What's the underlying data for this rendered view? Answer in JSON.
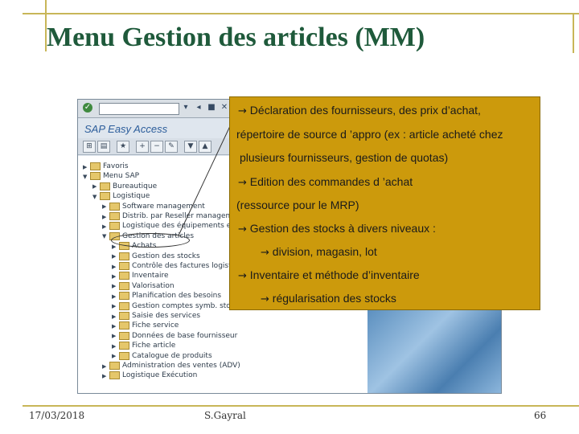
{
  "slide": {
    "title": "Menu Gestion des articles (MM)",
    "footer_date": "17/03/2018",
    "footer_author": "S.Gayral",
    "footer_page": "66"
  },
  "sap": {
    "screen_title": "SAP Easy Access",
    "tree": [
      {
        "label": "Favoris",
        "level": 0,
        "expanded": false
      },
      {
        "label": "Menu SAP",
        "level": 0,
        "expanded": true
      },
      {
        "label": "Bureautique",
        "level": 1,
        "expanded": false
      },
      {
        "label": "Logistique",
        "level": 1,
        "expanded": true
      },
      {
        "label": "Software management",
        "level": 2,
        "expanded": false
      },
      {
        "label": "Distrib. par Reseller management",
        "level": 2,
        "expanded": false
      },
      {
        "label": "Logistique des équipements et clie",
        "level": 2,
        "expanded": false
      },
      {
        "label": "Gestion des articles",
        "level": 2,
        "expanded": true
      },
      {
        "label": "Achats",
        "level": 3,
        "expanded": false
      },
      {
        "label": "Gestion des stocks",
        "level": 3,
        "expanded": false
      },
      {
        "label": "Contrôle des factures logistique",
        "level": 3,
        "expanded": false
      },
      {
        "label": "Inventaire",
        "level": 3,
        "expanded": false
      },
      {
        "label": "Valorisation",
        "level": 3,
        "expanded": false
      },
      {
        "label": "Planification des besoins",
        "level": 3,
        "expanded": false
      },
      {
        "label": "Gestion comptes symb. stocks consignation",
        "level": 3,
        "expanded": false
      },
      {
        "label": "Saisie des services",
        "level": 3,
        "expanded": false
      },
      {
        "label": "Fiche service",
        "level": 3,
        "expanded": false
      },
      {
        "label": "Données de base fournisseur",
        "level": 3,
        "expanded": false
      },
      {
        "label": "Fiche article",
        "level": 3,
        "expanded": false
      },
      {
        "label": "Catalogue de produits",
        "level": 3,
        "expanded": false
      },
      {
        "label": "Administration des ventes (ADV)",
        "level": 2,
        "expanded": false
      },
      {
        "label": "Logistique Exécution",
        "level": 2,
        "expanded": false
      }
    ]
  },
  "callout": {
    "lines": [
      {
        "arrow": "→",
        "text": "Déclaration des fournisseurs, des prix d’achat,"
      },
      {
        "arrow": "",
        "text": "répertoire de source d ’appro (ex : article acheté chez"
      },
      {
        "arrow": "",
        "text": "plusieurs fournisseurs, gestion de quotas)"
      },
      {
        "arrow": "→",
        "text": "Edition des commandes d ’achat"
      },
      {
        "arrow": "",
        "text": "(ressource pour le MRP)"
      },
      {
        "arrow": "→",
        "text": "Gestion des stocks à divers niveaux :"
      },
      {
        "arrow": "→",
        "text": "division, magasin, lot"
      },
      {
        "arrow": "→",
        "text": "Inventaire et méthode d’inventaire"
      },
      {
        "arrow": "→",
        "text": "régularisation des stocks"
      }
    ]
  },
  "colors": {
    "title": "#1f5a3b",
    "rule": "#c8b658",
    "callout_bg": "#cc9a0c",
    "sap_title": "#2c5d9b"
  }
}
